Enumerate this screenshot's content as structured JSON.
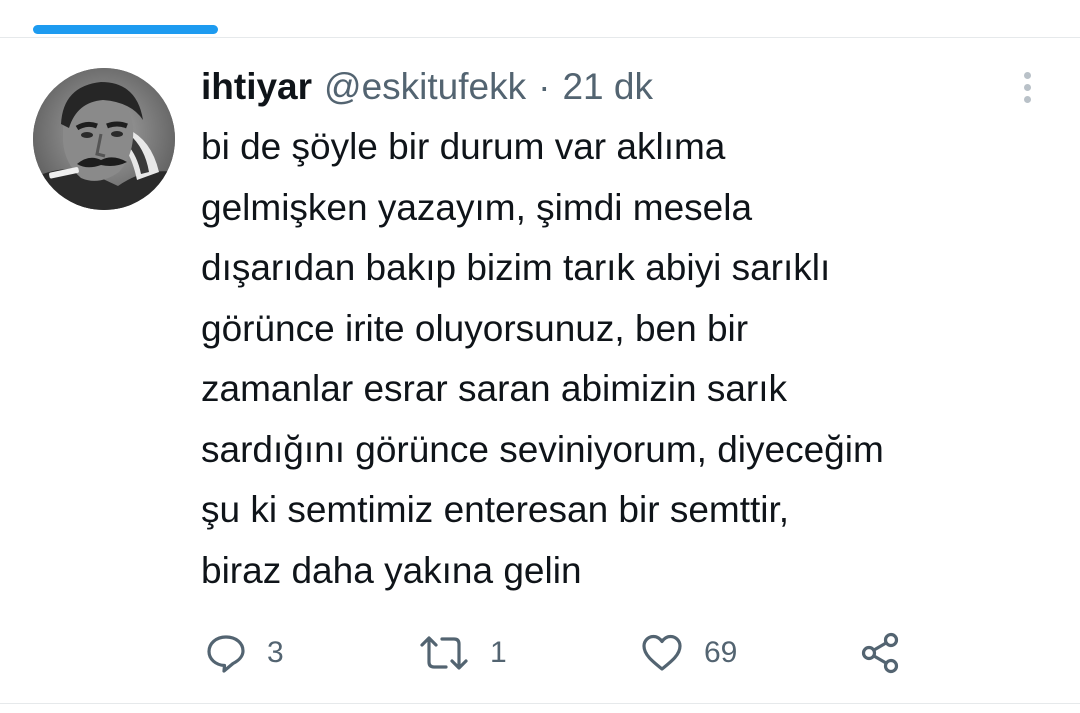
{
  "tweet": {
    "display_name": "ihtiyar",
    "handle": "@eskitufekk",
    "separator": "·",
    "time": "21 dk",
    "text_lines": [
      "bi de şöyle bir durum var aklıma",
      "gelmişken yazayım, şimdi mesela",
      "dışarıdan bakıp bizim tarık abiyi sarıklı",
      "görünce irite oluyorsunuz, ben bir",
      "zamanlar esrar saran abimizin sarık",
      "sardığını görünce seviniyorum, diyeceğim",
      "şu ki semtimiz enteresan bir semttir,",
      "biraz daha yakına gelin"
    ]
  },
  "actions": {
    "reply": {
      "icon": "reply-icon",
      "count": "3"
    },
    "retweet": {
      "icon": "retweet-icon",
      "count": "1"
    },
    "like": {
      "icon": "heart-icon",
      "count": "69"
    },
    "share": {
      "icon": "share-icon"
    }
  },
  "icons": {
    "more": "more-vertical-icon"
  },
  "colors": {
    "accent": "#1d9bf0",
    "text": "#0f1419",
    "secondary": "#536471",
    "divider": "#e6e9eb"
  }
}
